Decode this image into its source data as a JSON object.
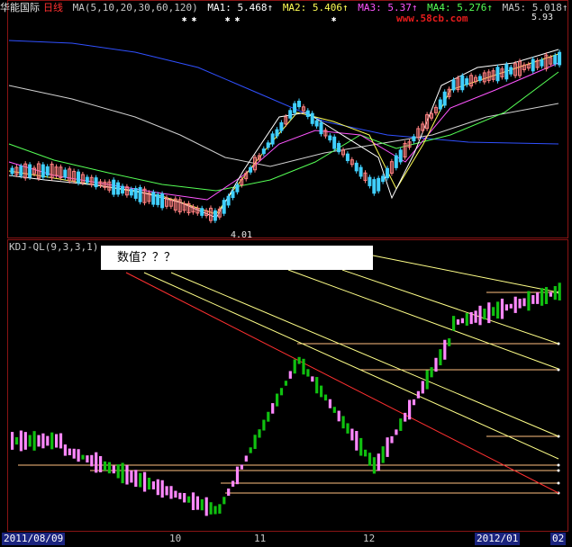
{
  "header": {
    "name": "华能国际",
    "period": "日线",
    "ma_def": "MA(5,10,20,30,60,120)",
    "ma1": "MA1: 5.468↑",
    "ma2": "MA2: 5.406↑",
    "ma3": "MA3: 5.37↑",
    "ma4": "MA4: 5.276↑",
    "ma5": "MA5: 5.018↑"
  },
  "indicator": {
    "label": "KDJ-QL(9,3,3,1)"
  },
  "callout": {
    "text": "数值？？？"
  },
  "price_labels": {
    "low": "4.01",
    "high": "5.93"
  },
  "date_axis": {
    "labels": [
      "2011/08/09",
      "10",
      "11",
      "12",
      "2012/01",
      "02"
    ]
  },
  "watermark": "www.58cb.com",
  "markers": {
    "stars_left": "✱ ✱",
    "stars_mid": "✱ ✱",
    "stars_right": "✱"
  },
  "colors": {
    "frame": "#8a1414",
    "up_candle": "#ff8080",
    "down_candle": "#40d0ff",
    "ma1": "#ffffff",
    "ma2": "#ffff55",
    "ma3": "#ff55ff",
    "ma4": "#55ff55",
    "ma5": "#d0d0d0",
    "ma6": "#3050ff",
    "kdj_up": "#ff88ff",
    "kdj_down": "#10c010"
  }
}
